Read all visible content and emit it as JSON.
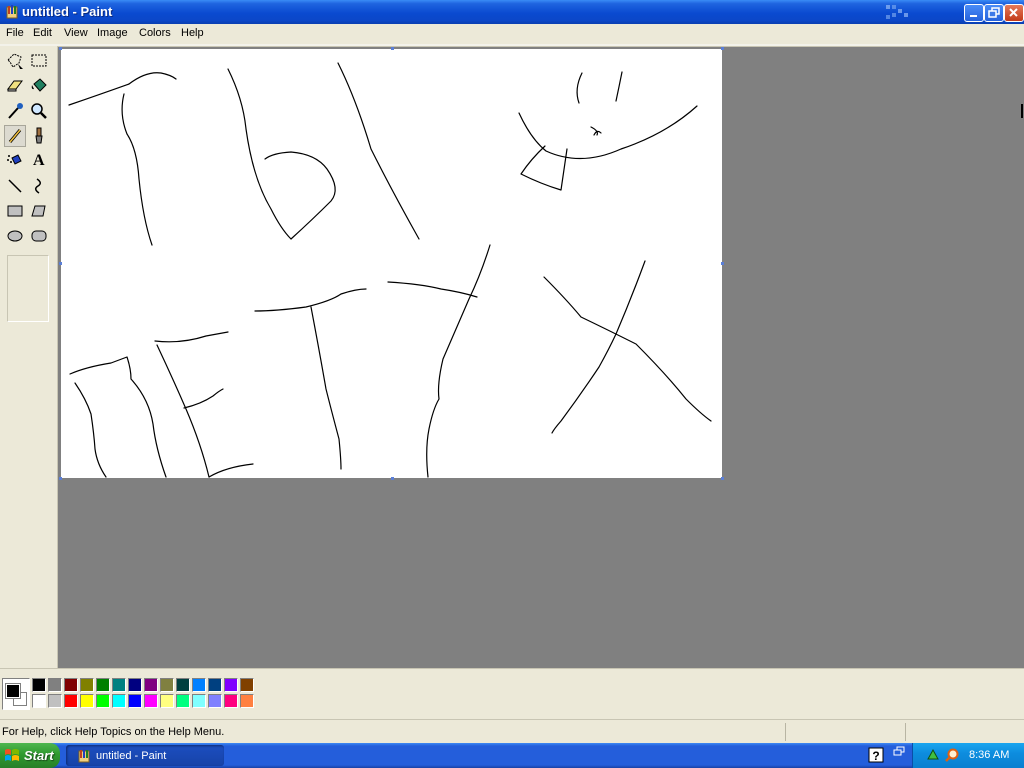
{
  "window": {
    "title": "untitled - Paint"
  },
  "menu": {
    "items": [
      "File",
      "Edit",
      "View",
      "Image",
      "Colors",
      "Help"
    ]
  },
  "toolbox": {
    "tools": [
      {
        "name": "free-form-select-icon",
        "active": false
      },
      {
        "name": "select-icon",
        "active": false
      },
      {
        "name": "eraser-icon",
        "active": false
      },
      {
        "name": "fill-with-color-icon",
        "active": false
      },
      {
        "name": "pick-color-icon",
        "active": false
      },
      {
        "name": "magnifier-icon",
        "active": false
      },
      {
        "name": "pencil-icon",
        "active": true
      },
      {
        "name": "brush-icon",
        "active": false
      },
      {
        "name": "airbrush-icon",
        "active": false
      },
      {
        "name": "text-icon",
        "active": false
      },
      {
        "name": "line-icon",
        "active": false
      },
      {
        "name": "curve-icon",
        "active": false
      },
      {
        "name": "rectangle-icon",
        "active": false
      },
      {
        "name": "polygon-icon",
        "active": false
      },
      {
        "name": "ellipse-icon",
        "active": false
      },
      {
        "name": "rounded-rectangle-icon",
        "active": false
      }
    ],
    "text_tool_glyph": "A"
  },
  "palette": {
    "foreground": "#000000",
    "background": "#ffffff",
    "row1": [
      "#000000",
      "#808080",
      "#800000",
      "#808000",
      "#008000",
      "#008080",
      "#000080",
      "#800080",
      "#808040",
      "#004040",
      "#0080ff",
      "#004080",
      "#8000ff",
      "#804000"
    ],
    "row2": [
      "#ffffff",
      "#c0c0c0",
      "#ff0000",
      "#ffff00",
      "#00ff00",
      "#00ffff",
      "#0000ff",
      "#ff00ff",
      "#ffff80",
      "#00ff80",
      "#80ffff",
      "#8080ff",
      "#ff0080",
      "#ff8040"
    ]
  },
  "statusbar": {
    "help_text": "For Help, click Help Topics on the Help Menu."
  },
  "taskbar": {
    "start_label": "Start",
    "task_label": "untitled - Paint",
    "clock": "8:36 AM"
  }
}
